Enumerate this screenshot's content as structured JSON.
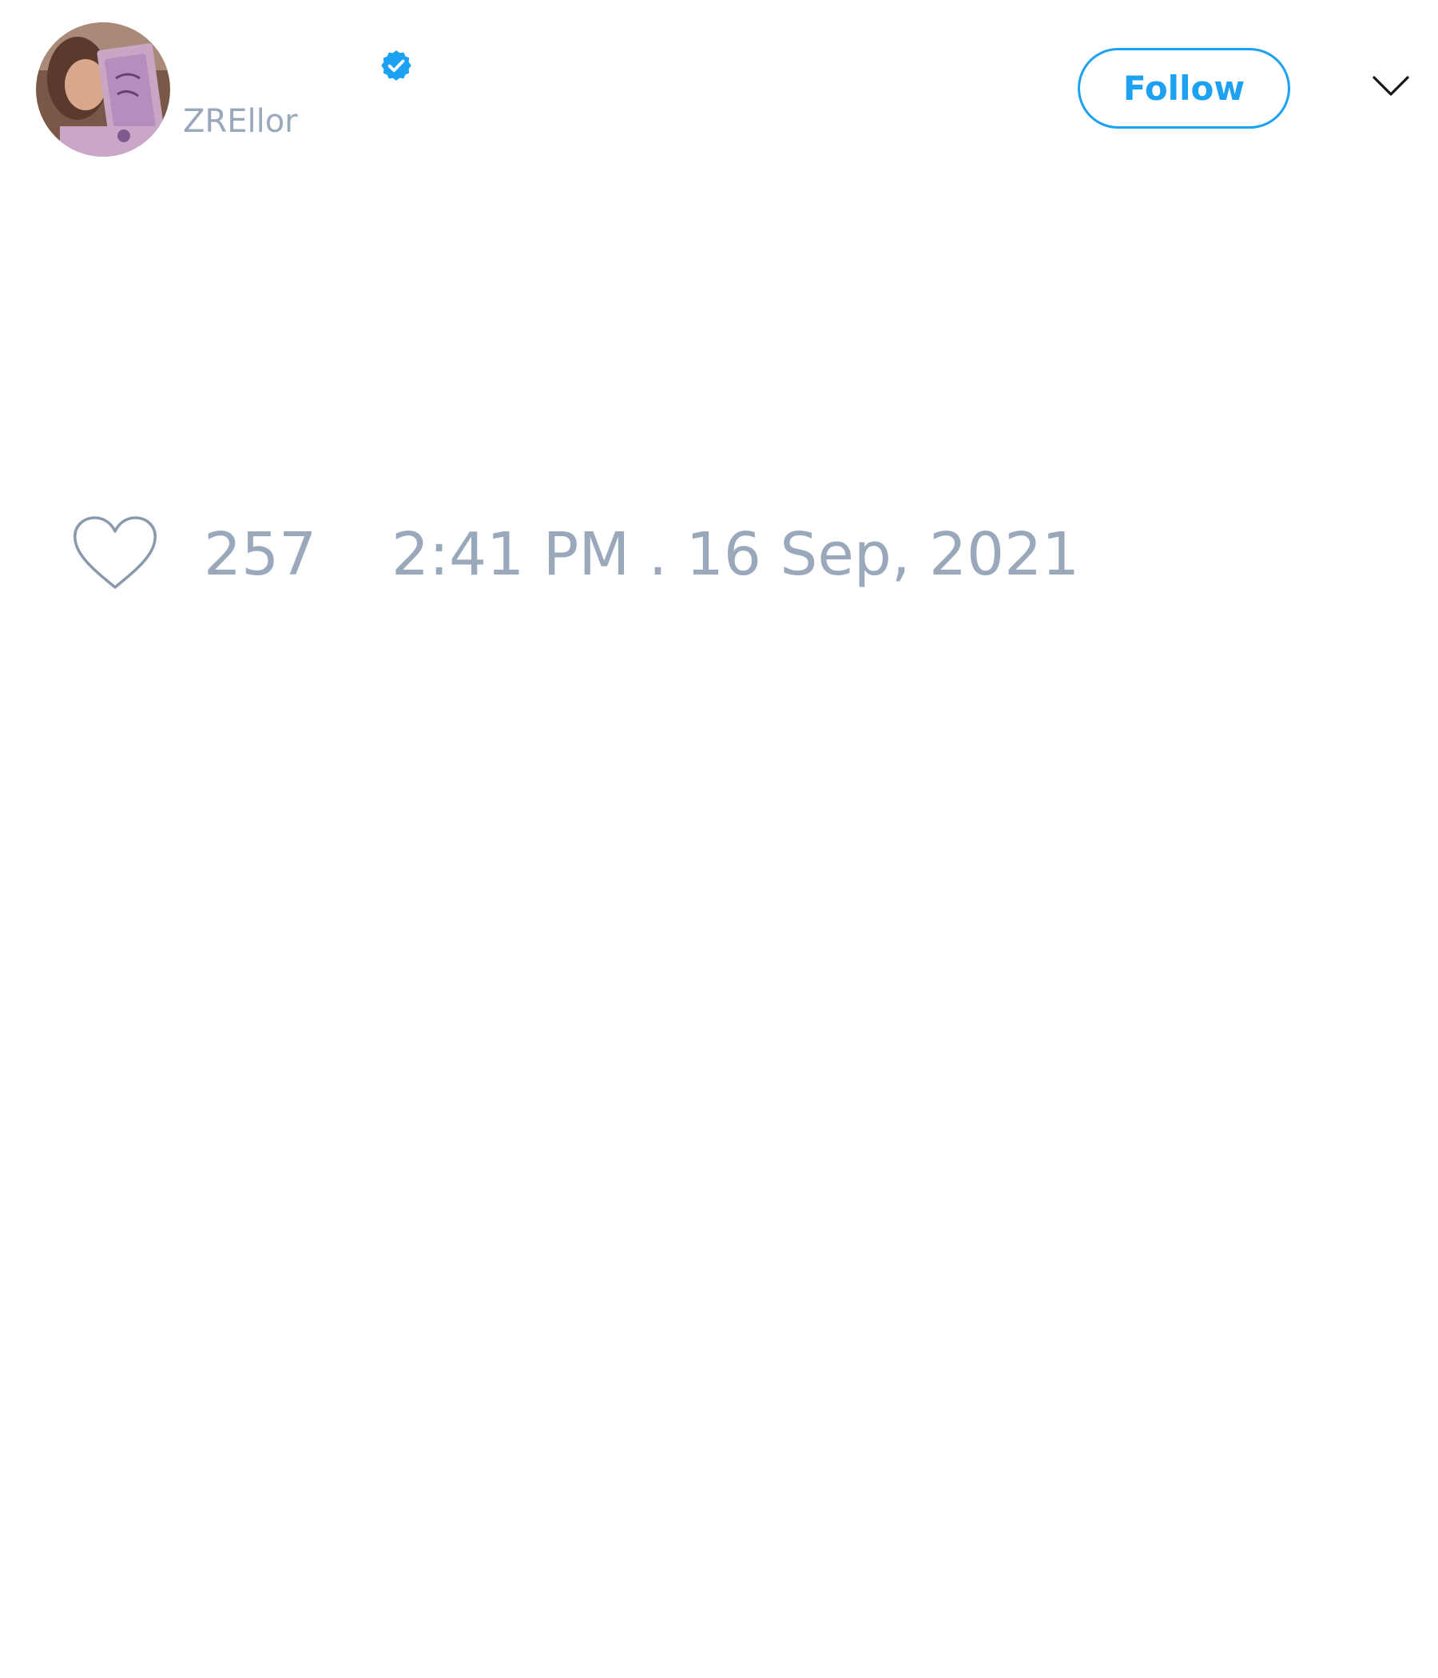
{
  "tweet": {
    "author": {
      "display_name": "",
      "handle": "ZREllor",
      "verified": true
    },
    "follow_label": "Follow",
    "like_count": "257",
    "timestamp": "2:41 PM . 16 Sep, 2021"
  },
  "icons": {
    "verified": "verified-badge-icon",
    "menu": "chevron-down-icon",
    "like": "heart-icon"
  },
  "colors": {
    "accent": "#1da1f2",
    "muted_text": "#9aa8bc",
    "icon_gray": "#8a99ab",
    "background": "#ffffff"
  }
}
